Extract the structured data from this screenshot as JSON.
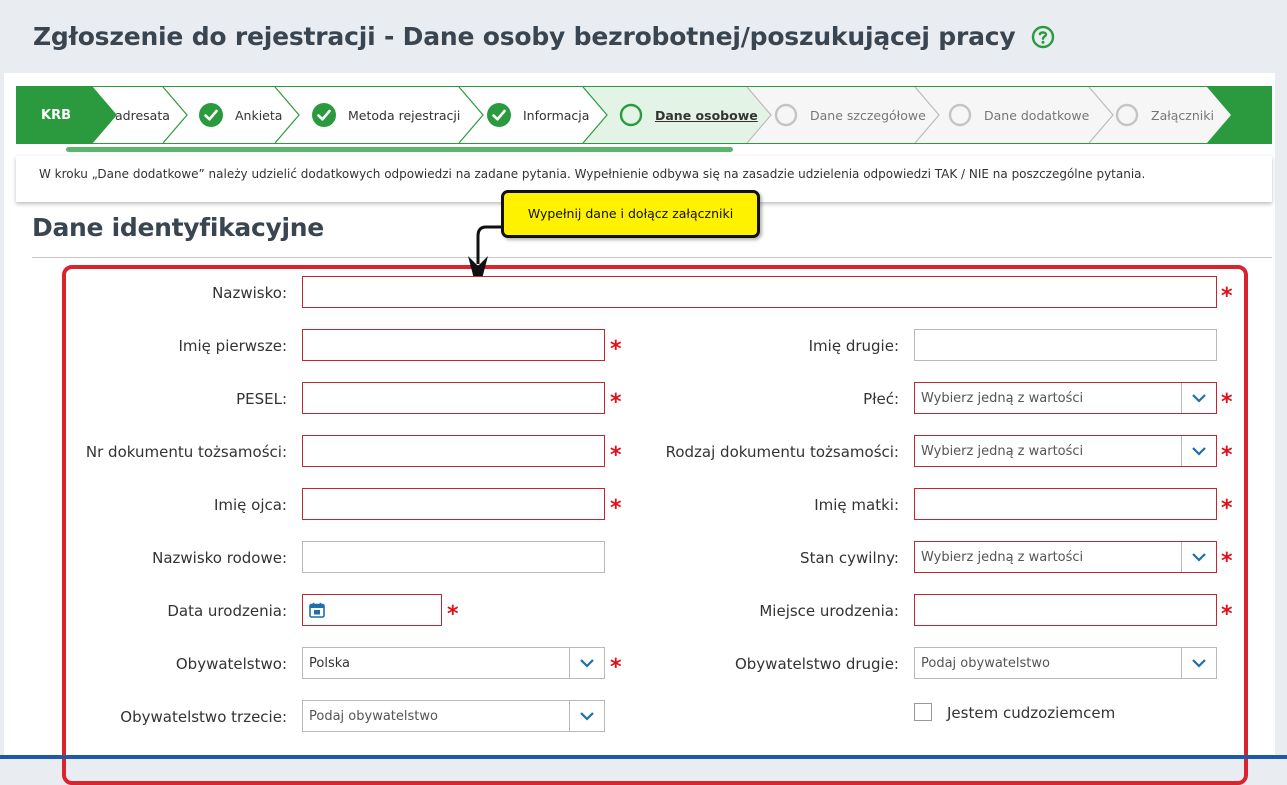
{
  "page": {
    "title": "Zgłoszenie do rejestracji - Dane osoby bezrobotnej/poszukującej pracy"
  },
  "stepper": {
    "krb": "KRB",
    "steps": [
      {
        "label": "adresata",
        "state": "done"
      },
      {
        "label": "Ankieta",
        "state": "done"
      },
      {
        "label": "Metoda rejestracji",
        "state": "done"
      },
      {
        "label": "Informacja",
        "state": "done"
      },
      {
        "label": "Dane osobowe",
        "state": "active"
      },
      {
        "label": "Dane szczegółowe",
        "state": "future"
      },
      {
        "label": "Dane dodatkowe",
        "state": "future"
      },
      {
        "label": "Załączniki",
        "state": "future"
      }
    ]
  },
  "info": {
    "text": "W kroku „Dane dodatkowe” należy udzielić dodatkowych odpowiedzi na zadane pytania. Wypełnienie odbywa się na zasadzie udzielenia odpowiedzi TAK / NIE na poszczególne pytania."
  },
  "tooltip": {
    "text": "Wypełnij dane i dołącz załączniki"
  },
  "section": {
    "title": "Dane identyfikacyjne"
  },
  "form": {
    "nazwisko": {
      "label": "Nazwisko:",
      "value": ""
    },
    "imie_pierwsze": {
      "label": "Imię pierwsze:",
      "value": ""
    },
    "imie_drugie": {
      "label": "Imię drugie:",
      "value": ""
    },
    "pesel": {
      "label": "PESEL:",
      "value": ""
    },
    "plec": {
      "label": "Płeć:",
      "value": "Wybierz jedną z wartości"
    },
    "nr_dokumentu": {
      "label": "Nr dokumentu tożsamości:",
      "value": ""
    },
    "rodzaj_dokumentu": {
      "label": "Rodzaj dokumentu tożsamości:",
      "value": "Wybierz jedną z wartości"
    },
    "imie_ojca": {
      "label": "Imię ojca:",
      "value": ""
    },
    "imie_matki": {
      "label": "Imię matki:",
      "value": ""
    },
    "nazwisko_rodowe": {
      "label": "Nazwisko rodowe:",
      "value": ""
    },
    "stan_cywilny": {
      "label": "Stan cywilny:",
      "value": "Wybierz jedną z wartości"
    },
    "data_urodzenia": {
      "label": "Data urodzenia:",
      "value": ""
    },
    "miejsce_urodzenia": {
      "label": "Miejsce urodzenia:",
      "value": ""
    },
    "obywatelstwo": {
      "label": "Obywatelstwo:",
      "value": "Polska"
    },
    "obywatelstwo_drugie": {
      "label": "Obywatelstwo drugie:",
      "value": "Podaj obywatelstwo"
    },
    "obywatelstwo_trzecie": {
      "label": "Obywatelstwo trzecie:",
      "value": "Podaj obywatelstwo"
    },
    "cudzoziemiec": {
      "label": "Jestem cudzoziemcem",
      "checked": false
    },
    "required_mark": "*"
  },
  "colors": {
    "green": "#2b9a3e",
    "red": "#d9232e",
    "tooltip_bg": "#fff200"
  }
}
